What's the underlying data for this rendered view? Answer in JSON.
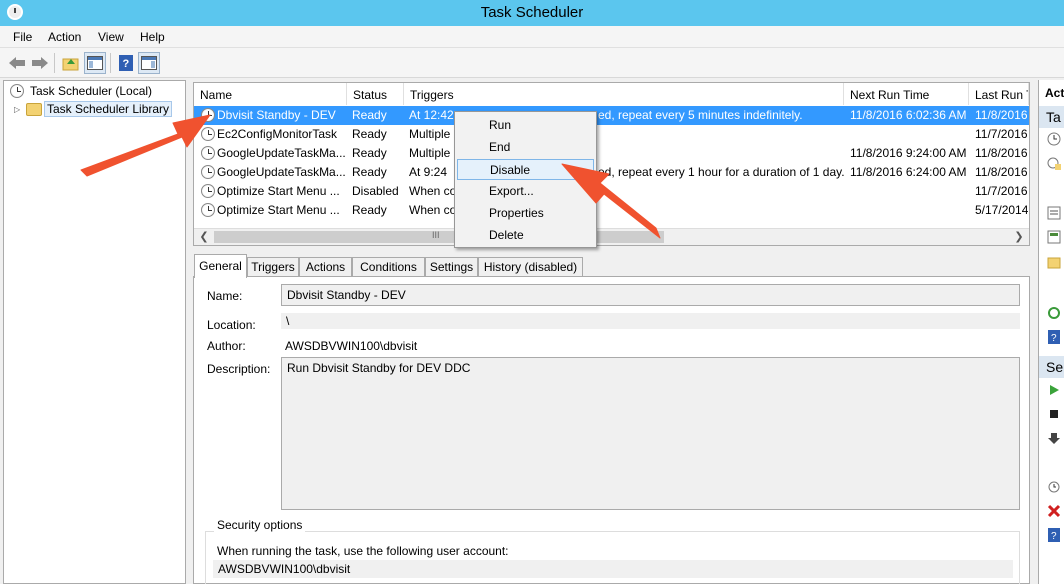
{
  "window": {
    "title": "Task Scheduler"
  },
  "menu": [
    "File",
    "Action",
    "View",
    "Help"
  ],
  "tree": {
    "root": "Task Scheduler (Local)",
    "library": "Task Scheduler Library"
  },
  "list": {
    "columns": [
      "Name",
      "Status",
      "Triggers",
      "Next Run Time",
      "Last Run T"
    ],
    "rows": [
      {
        "name": "Dbvisit Standby - DEV",
        "status": "Ready",
        "trigger_left": "At 12:42",
        "trigger_right": "ed, repeat every 5 minutes indefinitely.",
        "next": "11/8/2016 6:02:36 AM",
        "last": "11/8/2016"
      },
      {
        "name": "Ec2ConfigMonitorTask",
        "status": "Ready",
        "trigger_left": "Multiple",
        "trigger_right": "",
        "next": "",
        "last": "11/7/2016"
      },
      {
        "name": "GoogleUpdateTaskMa...",
        "status": "Ready",
        "trigger_left": "Multiple",
        "trigger_right": "",
        "next": "11/8/2016 9:24:00 AM",
        "last": "11/8/2016"
      },
      {
        "name": "GoogleUpdateTaskMa...",
        "status": "Ready",
        "trigger_left": "At 9:24",
        "trigger_right": "ed, repeat every 1 hour for a duration of 1 day.",
        "next": "11/8/2016 6:24:00 AM",
        "last": "11/8/2016"
      },
      {
        "name": "Optimize Start Menu ...",
        "status": "Disabled",
        "trigger_left": "When co",
        "trigger_right": "",
        "next": "",
        "last": "11/7/2016"
      },
      {
        "name": "Optimize Start Menu ...",
        "status": "Ready",
        "trigger_left": "When co",
        "trigger_right": "",
        "next": "",
        "last": "5/17/2014"
      }
    ],
    "scroll_grip": "III"
  },
  "context_menu": [
    "Run",
    "End",
    "Disable",
    "Export...",
    "Properties",
    "Delete"
  ],
  "tabs": [
    "General",
    "Triggers",
    "Actions",
    "Conditions",
    "Settings",
    "History (disabled)"
  ],
  "general": {
    "name_label": "Name:",
    "name_value": "Dbvisit Standby - DEV",
    "location_label": "Location:",
    "location_value": "\\",
    "author_label": "Author:",
    "author_value": "AWSDBVWIN100\\dbvisit",
    "description_label": "Description:",
    "description_value": "Run Dbvisit Standby for DEV DDC",
    "security_title": "Security options",
    "security_text": "When running the task, use the following user account:",
    "security_account": "AWSDBVWIN100\\dbvisit"
  },
  "actions_pane": {
    "header": "Acti",
    "sub1": "Ta",
    "sub2": "Se"
  },
  "colors": {
    "titlebar": "#5bc6ee",
    "selection": "#3399ff",
    "arrow": "#f0522f"
  }
}
